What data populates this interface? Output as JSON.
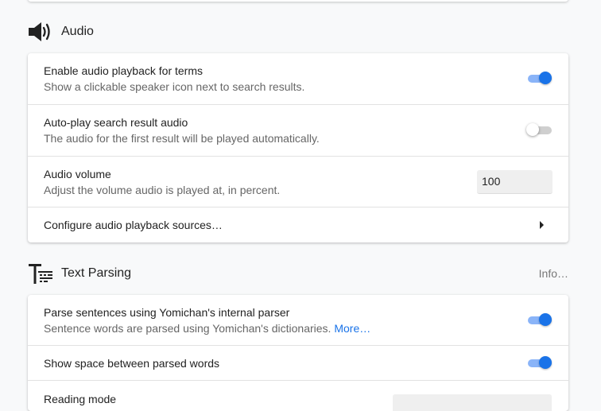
{
  "audio_section": {
    "title": "Audio",
    "icon": "speaker-icon",
    "rows": [
      {
        "label": "Enable audio playback for terms",
        "description": "Show a clickable speaker icon next to search results.",
        "control": "toggle",
        "checked": true
      },
      {
        "label": "Auto-play search result audio",
        "description": "The audio for the first result will be played automatically.",
        "control": "toggle",
        "checked": false
      },
      {
        "label": "Audio volume",
        "description": "Adjust the volume audio is played at, in percent.",
        "control": "number",
        "value": "100"
      },
      {
        "label": "Configure audio playback sources…",
        "control": "chevron"
      }
    ]
  },
  "text_parsing_section": {
    "title": "Text Parsing",
    "info_link": "Info…",
    "icon": "text-parsing-icon",
    "rows": [
      {
        "label": "Parse sentences using Yomichan's internal parser",
        "description": "Sentence words are parsed using Yomichan's dictionaries.",
        "description_link": "More…",
        "control": "toggle",
        "checked": true
      },
      {
        "label": "Show space between parsed words",
        "control": "toggle",
        "checked": true
      },
      {
        "label": "Reading mode",
        "control": "select"
      }
    ]
  },
  "colors": {
    "toggle_on_thumb": "#1a73e8",
    "toggle_on_track": "#8ab4f8",
    "link": "#1a73e8"
  }
}
